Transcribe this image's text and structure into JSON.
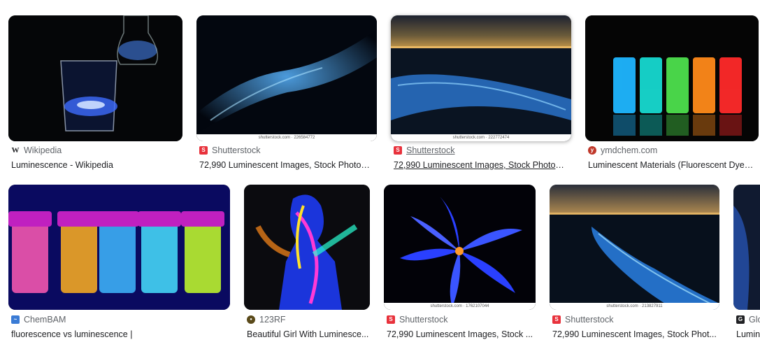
{
  "results": [
    {
      "source": "Wikipedia",
      "title": "Luminescence - Wikipedia",
      "favicon": "wikipedia-icon"
    },
    {
      "source": "Shutterstock",
      "title": "72,990 Luminescent Images, Stock Photos ...",
      "favicon": "shutterstock-icon",
      "watermark": "shutterstock.com · 226584772"
    },
    {
      "source": "Shutterstock",
      "title": "72,990 Luminescent Images, Stock Photos ...",
      "favicon": "shutterstock-icon",
      "watermark": "shutterstock.com · 222772474"
    },
    {
      "source": "ymdchem.com",
      "title": "Luminescent Materials (Fluorescent Dyes) ...",
      "favicon": "ymdchem-icon"
    },
    {
      "source": "ChemBAM",
      "title": "fluorescence vs luminescence |",
      "favicon": "chembam-icon"
    },
    {
      "source": "123RF",
      "title": "Beautiful Girl With Luminesce...",
      "favicon": "123rf-icon"
    },
    {
      "source": "Shutterstock",
      "title": "72,990 Luminescent Images, Stock ...",
      "favicon": "shutterstock-icon",
      "watermark": "shutterstock.com · 1762107044"
    },
    {
      "source": "Shutterstock",
      "title": "72,990 Luminescent Images, Stock Phot...",
      "favicon": "shutterstock-icon",
      "watermark": "shutterstock.com · 213827911"
    },
    {
      "source": "Glo",
      "title": "Lumin",
      "favicon": "glo-icon"
    }
  ],
  "colors": {
    "shutterstock": "#e8323c",
    "accent_blue": "#1a73e8",
    "text": "#202124",
    "muted": "#5f6368"
  }
}
